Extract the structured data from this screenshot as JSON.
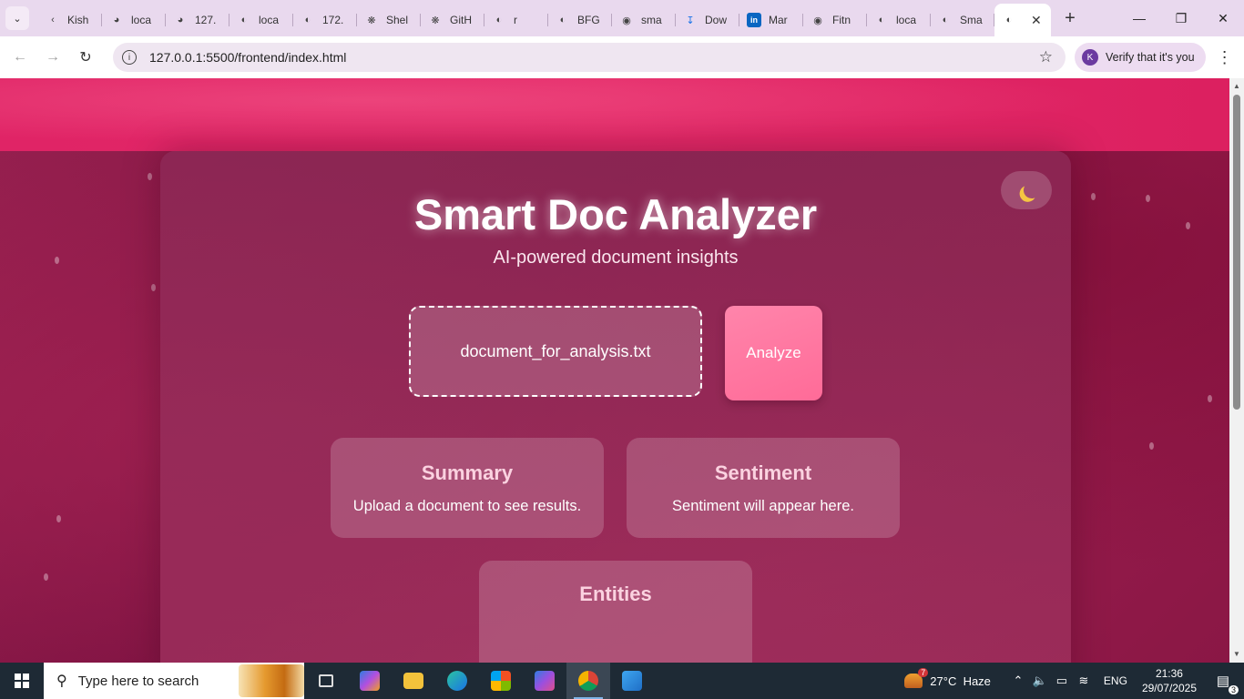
{
  "browser": {
    "tabs": [
      {
        "label": "Kish",
        "icon": "kishan-icon"
      },
      {
        "label": "loca",
        "icon": "compass-icon"
      },
      {
        "label": "127.",
        "icon": "compass-icon"
      },
      {
        "label": "loca",
        "icon": "globe-icon"
      },
      {
        "label": "172.",
        "icon": "globe-icon"
      },
      {
        "label": "Shel",
        "icon": "openai-icon"
      },
      {
        "label": "GitH",
        "icon": "openai-icon"
      },
      {
        "label": "r",
        "icon": "globe-icon"
      },
      {
        "label": "BFG",
        "icon": "globe-icon"
      },
      {
        "label": "sma",
        "icon": "github-icon"
      },
      {
        "label": "Dow",
        "icon": "download-icon"
      },
      {
        "label": "Mar",
        "icon": "linkedin-icon"
      },
      {
        "label": "Fitn",
        "icon": "github-icon"
      },
      {
        "label": "loca",
        "icon": "globe-icon"
      },
      {
        "label": "Sma",
        "icon": "globe-icon"
      }
    ],
    "address": "127.0.0.1:5500/frontend/index.html",
    "profile_label": "Verify that it's you",
    "profile_initial": "K"
  },
  "page": {
    "title": "Smart Doc Analyzer",
    "subtitle": "AI-powered document insights",
    "file_name": "document_for_analysis.txt",
    "analyze_label": "Analyze",
    "cards": {
      "summary": {
        "title": "Summary",
        "text": "Upload a document to see results."
      },
      "sentiment": {
        "title": "Sentiment",
        "text": "Sentiment will appear here."
      },
      "entities": {
        "title": "Entities",
        "text": ""
      }
    },
    "colors": {
      "header": "#e32968",
      "background": "#8a1644",
      "accent": "#ff6b98"
    }
  },
  "taskbar": {
    "search_placeholder": "Type here to search",
    "weather": "27°C  Haze",
    "weather_badge": "7",
    "language": "ENG",
    "time": "21:36",
    "date": "29/07/2025",
    "notification_count": "3"
  }
}
